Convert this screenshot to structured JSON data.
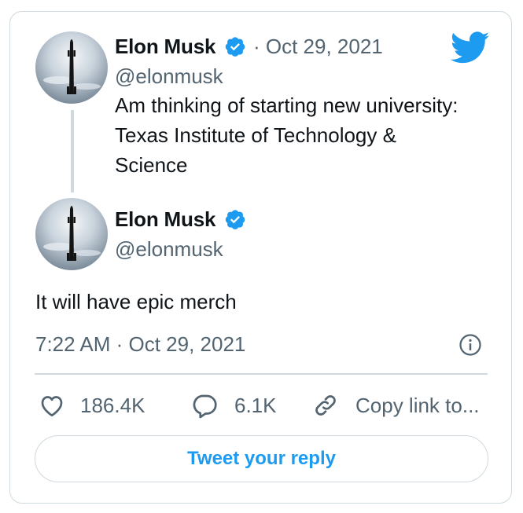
{
  "colors": {
    "accent": "#1d9bf0",
    "text": "#0f1419",
    "muted": "#536471",
    "border": "#cfd9de"
  },
  "original_tweet": {
    "author_name": "Elon Musk",
    "meta": "· Oct 29, 2021",
    "handle": "@elonmusk",
    "text_lines": [
      "Am thinking of starting new university:",
      "Texas Institute of Technology &",
      "Science"
    ],
    "avatar_icon": "starship-avatar",
    "verified_icon": "verified-badge-icon"
  },
  "reply_tweet": {
    "author_name": "Elon Musk",
    "handle": "@elonmusk",
    "text": "It will have epic merch",
    "timestamp": "7:22 AM · Oct 29, 2021",
    "info_icon": "info-icon"
  },
  "actions": {
    "likes": "186.4K",
    "replies": "6.1K",
    "copy_link": "Copy link to..."
  },
  "reply_button_label": "Tweet your reply",
  "brand_icon": "twitter-bird-icon"
}
